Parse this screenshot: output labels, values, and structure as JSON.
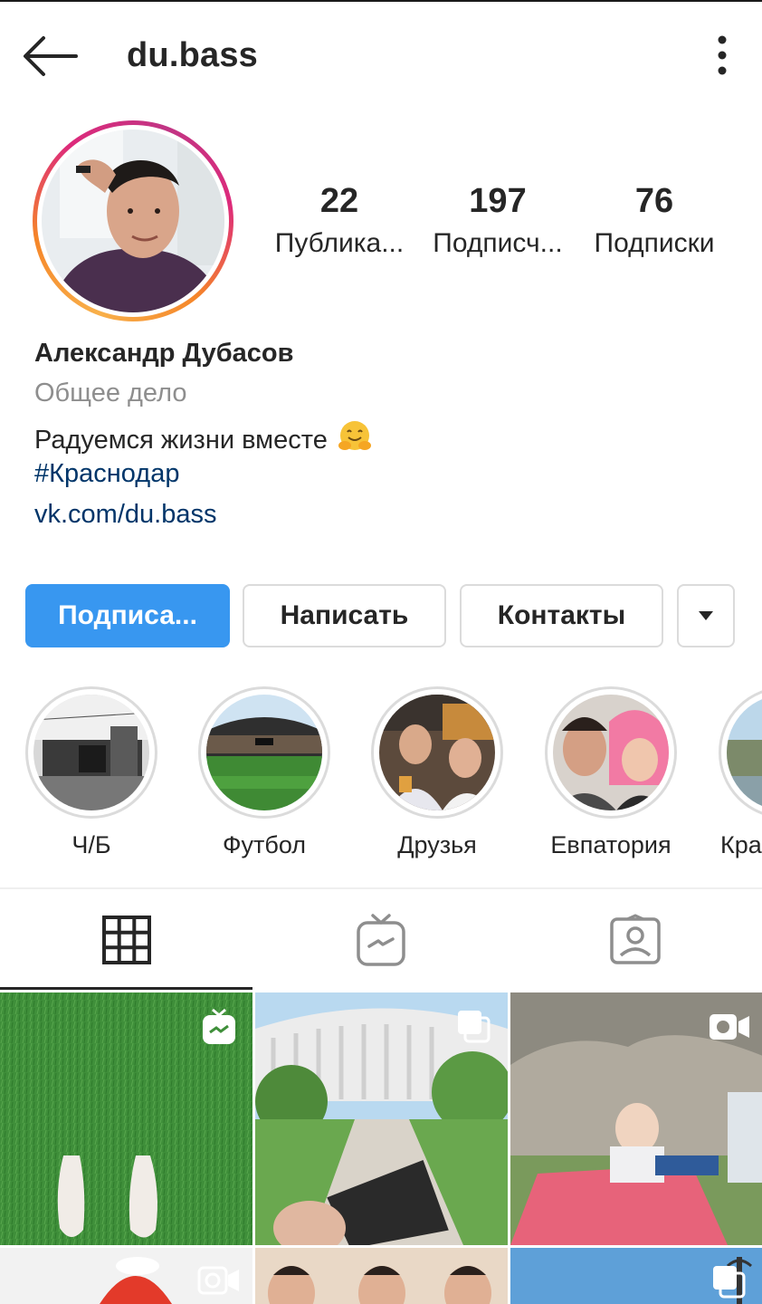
{
  "header": {
    "username": "du.bass"
  },
  "stats": [
    {
      "value": "22",
      "label": "Публика..."
    },
    {
      "value": "197",
      "label": "Подписч..."
    },
    {
      "value": "76",
      "label": "Подписки"
    }
  ],
  "bio": {
    "name": "Александр Дубасов",
    "category": "Общее дело",
    "text": "Радуемся жизни вместе",
    "hashtag": "#Краснодар",
    "link": "vk.com/du.bass"
  },
  "buttons": {
    "follow": "Подписа...",
    "message": "Написать",
    "contacts": "Контакты"
  },
  "highlights": [
    {
      "label": "Ч/Б"
    },
    {
      "label": "Футбол"
    },
    {
      "label": "Друзья"
    },
    {
      "label": "Евпатория"
    },
    {
      "label": "Кра"
    }
  ],
  "tabs": [
    {
      "icon": "grid-icon",
      "active": true
    },
    {
      "icon": "igtv-icon",
      "active": false
    },
    {
      "icon": "tagged-icon",
      "active": false
    }
  ],
  "colors": {
    "accent": "#3897f0",
    "link": "#003569",
    "muted": "#8e8e8e"
  }
}
